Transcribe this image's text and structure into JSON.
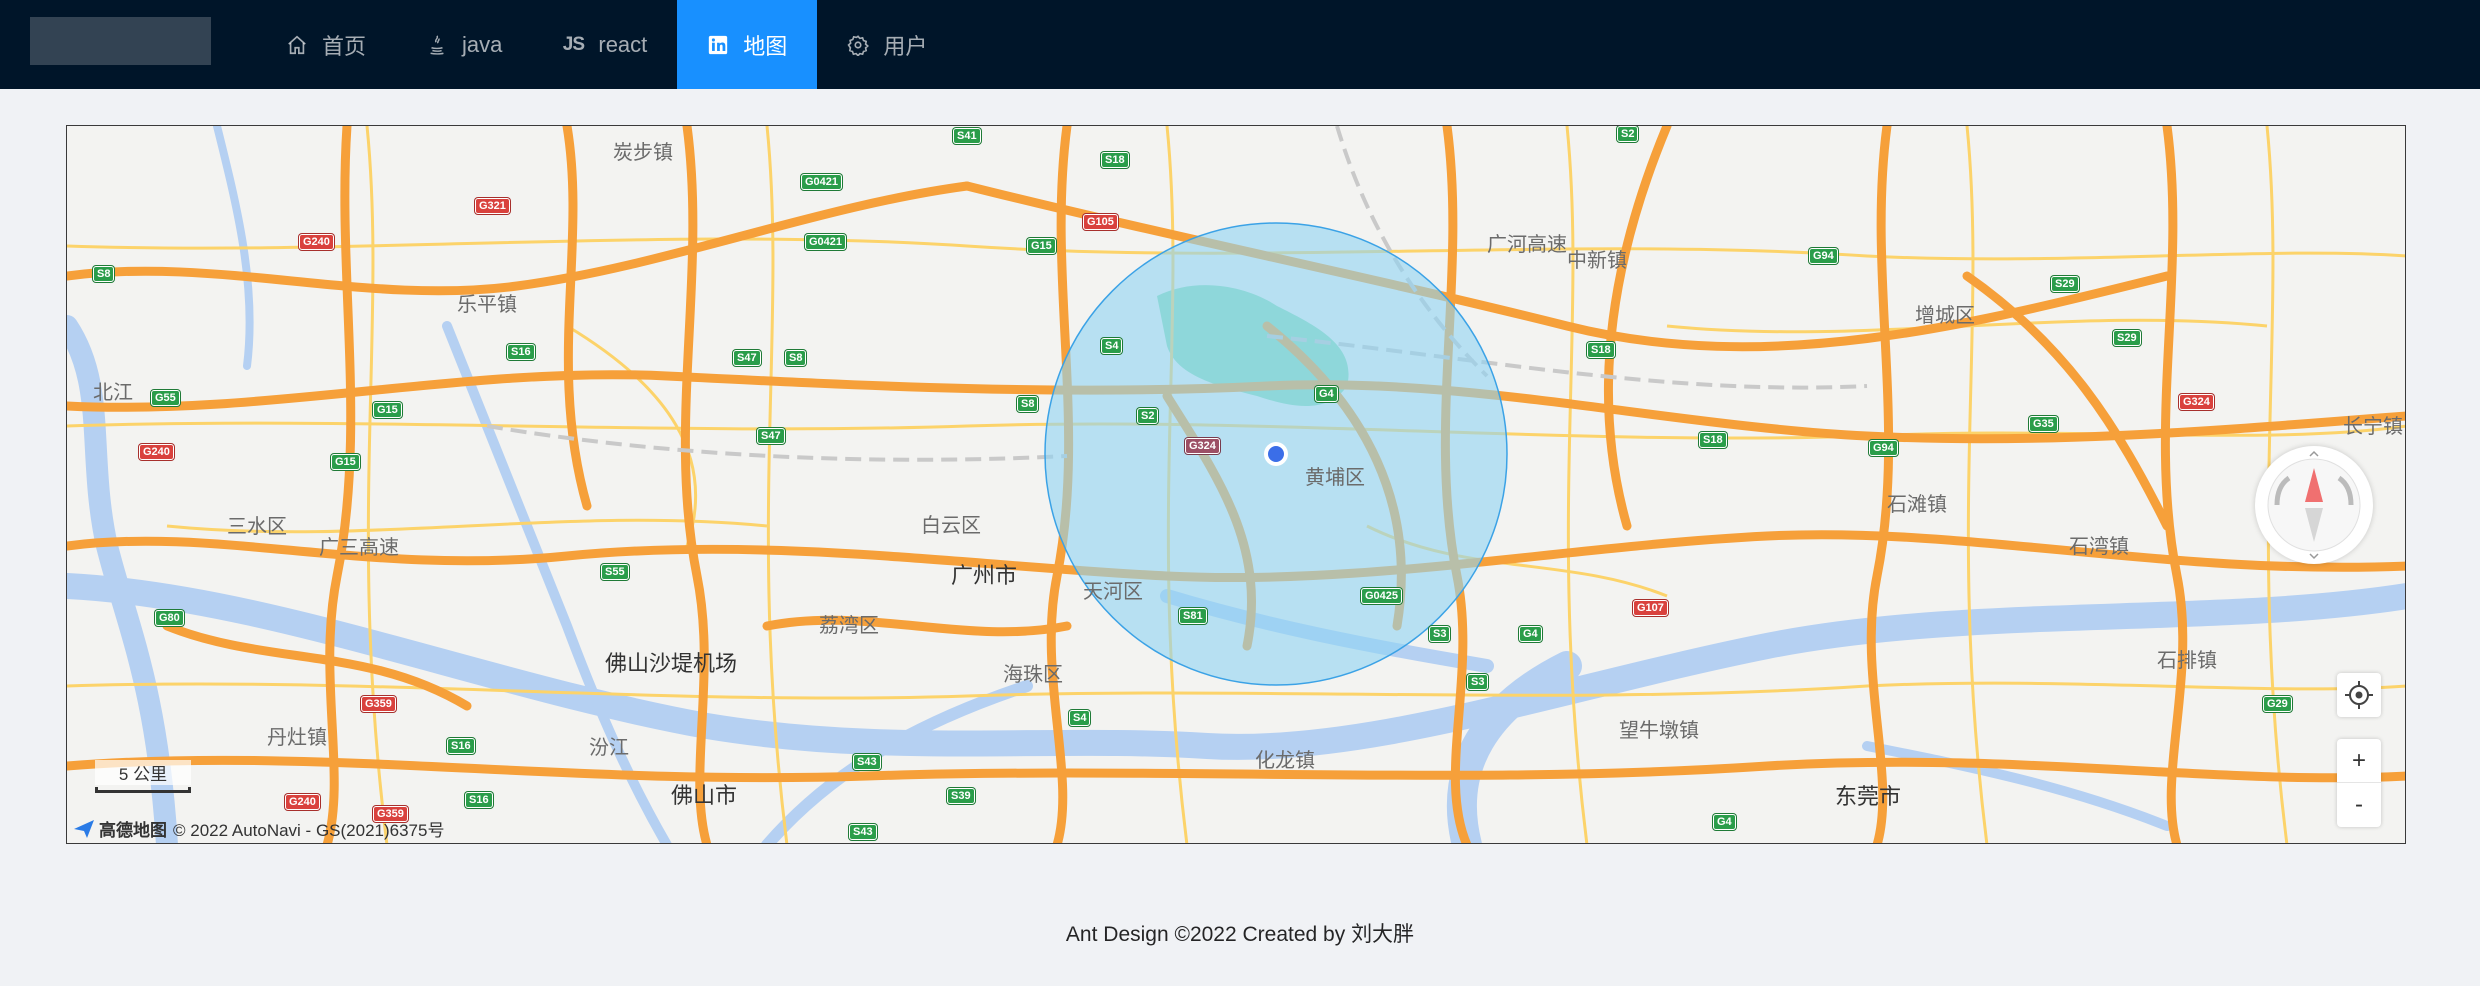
{
  "nav": {
    "items": [
      {
        "label": "首页",
        "icon": "home-icon",
        "active": false
      },
      {
        "label": "java",
        "icon": "java-icon",
        "active": false
      },
      {
        "label": "react",
        "icon": "js-icon",
        "icon_text": "JS",
        "active": false
      },
      {
        "label": "地图",
        "icon": "linkedin-icon",
        "active": true
      },
      {
        "label": "用户",
        "icon": "gear-icon",
        "active": false
      }
    ]
  },
  "map": {
    "places": [
      {
        "name": "炭步镇"
      },
      {
        "name": "乐平镇"
      },
      {
        "name": "三水区"
      },
      {
        "name": "白云区"
      },
      {
        "name": "广州市"
      },
      {
        "name": "荔湾区"
      },
      {
        "name": "天河区"
      },
      {
        "name": "海珠区"
      },
      {
        "name": "黄埔区"
      },
      {
        "name": "中新镇"
      },
      {
        "name": "增城区"
      },
      {
        "name": "石滩镇"
      },
      {
        "name": "石湾镇"
      },
      {
        "name": "石排镇"
      },
      {
        "name": "长宁镇"
      },
      {
        "name": "望牛墩镇"
      },
      {
        "name": "东莞市"
      },
      {
        "name": "化龙镇"
      },
      {
        "name": "丹灶镇"
      },
      {
        "name": "佛山市"
      },
      {
        "name": "佛山沙堤机场"
      },
      {
        "name": "汾江"
      },
      {
        "name": "北江"
      },
      {
        "name": "广三高速"
      },
      {
        "name": "广河高速"
      }
    ],
    "road_badges": [
      "S41",
      "S18",
      "G0421",
      "G0421",
      "G321",
      "G240",
      "S8",
      "G105",
      "G15",
      "G94",
      "S29",
      "S29",
      "S16",
      "S47",
      "S8",
      "S4",
      "S18",
      "G4",
      "S2",
      "S8",
      "G55",
      "G240",
      "G15",
      "G15",
      "S47",
      "G324",
      "S18",
      "G94",
      "G35",
      "G324",
      "S55",
      "G80",
      "G0425",
      "G107",
      "S81",
      "S3",
      "G4",
      "S3",
      "G359",
      "S16",
      "S4",
      "S43",
      "S39",
      "S16",
      "G240",
      "G359",
      "S43",
      "G4",
      "G29",
      "S2"
    ],
    "circle": {
      "center_label": "",
      "fill": "#8fd3f4",
      "stroke": "#3ba2e6"
    },
    "scale_label": "5 公里",
    "brand": "高德地图",
    "copyright": "© 2022 AutoNavi - GS(2021)6375号",
    "zoom_in": "+",
    "zoom_out": "-"
  },
  "footer": {
    "text": "Ant Design ©2022 Created by 刘大胖"
  }
}
